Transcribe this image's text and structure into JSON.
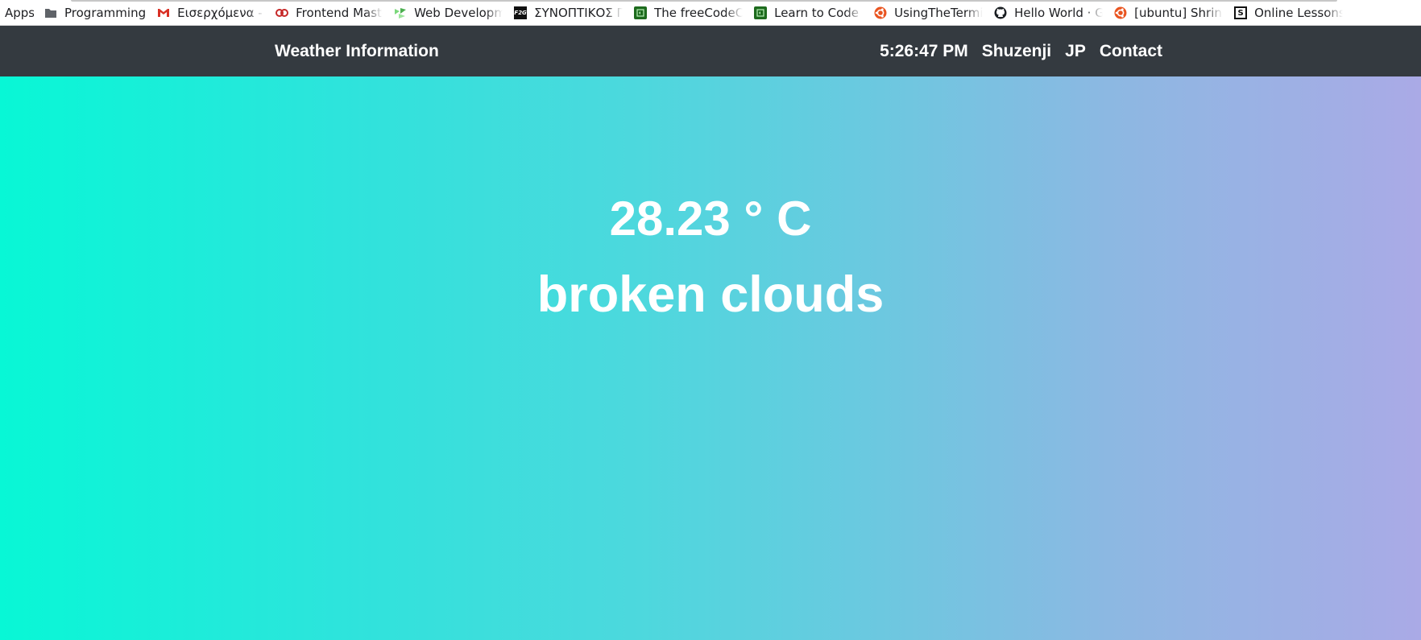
{
  "bookmarks": [
    {
      "label": "Apps",
      "icon": "apps-icon"
    },
    {
      "label": "Programming",
      "icon": "folder-icon"
    },
    {
      "label": "Εισερχόμενα - d",
      "icon": "gmail-icon"
    },
    {
      "label": "Frontend Maste",
      "icon": "frontend-masters-icon"
    },
    {
      "label": "Web Developme",
      "icon": "green-flag-icon"
    },
    {
      "label": "ΣΥΝΟΠΤΙΚΟΣ ΠΙ",
      "icon": "f2g-icon"
    },
    {
      "label": "The freeCodeCa",
      "icon": "freecodecamp-icon"
    },
    {
      "label": "Learn to Code ar",
      "icon": "freecodecamp-icon"
    },
    {
      "label": "UsingTheTermin",
      "icon": "ubuntu-icon"
    },
    {
      "label": "Hello World · Git",
      "icon": "github-icon"
    },
    {
      "label": "[ubuntu] Shrink",
      "icon": "ubuntu-icon"
    },
    {
      "label": "Online Lessons",
      "icon": "s-logo-icon"
    }
  ],
  "navbar": {
    "brand": "Weather Information",
    "time": "5:26:47 PM",
    "city": "Shuzenji",
    "country": "JP",
    "contact": "Contact"
  },
  "weather": {
    "temperature": "28.23 ° C",
    "description": "broken clouds"
  }
}
